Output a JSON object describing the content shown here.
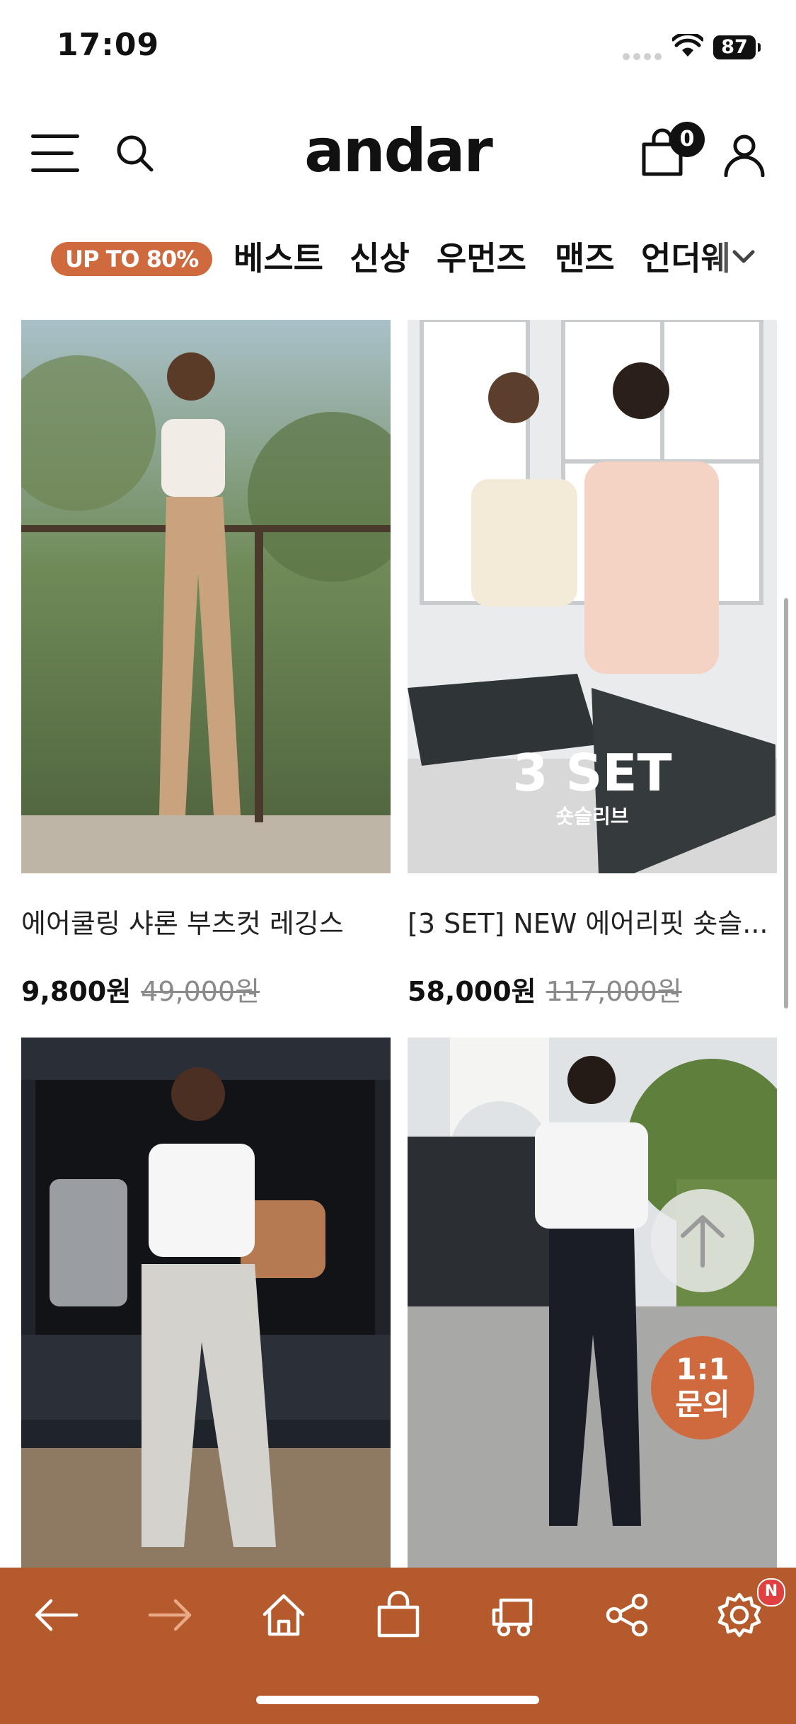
{
  "status": {
    "time": "17:09",
    "battery": "87"
  },
  "header": {
    "logo": "andar",
    "cart_count": "0"
  },
  "nav": {
    "promo": "UP TO 80%",
    "categories": [
      "베스트",
      "신상",
      "우먼즈",
      "맨즈",
      "언더웨"
    ]
  },
  "products": [
    {
      "name": "에어쿨링 샤론 부츠컷 레깅스",
      "price": "9,800원",
      "old_price": "49,000원"
    },
    {
      "name": "[3 SET] NEW 에어리핏 숏슬...",
      "price": "58,000원",
      "old_price": "117,000원",
      "overlay_title": "3 SET",
      "overlay_sub": "숏슬리브"
    },
    {
      "name": "",
      "price": "",
      "old_price": ""
    },
    {
      "name": "",
      "price": "",
      "old_price": ""
    }
  ],
  "floating": {
    "inquiry_line1": "1:1",
    "inquiry_line2": "문의"
  },
  "toolbar": {
    "icons": [
      "back-arrow-icon",
      "forward-arrow-icon",
      "home-icon",
      "shopping-bag-icon",
      "delivery-truck-icon",
      "share-icon",
      "settings-icon"
    ],
    "settings_badge": "N"
  },
  "colors": {
    "accent": "#cf6a3f",
    "toolbar_bg": "#b55a2c"
  }
}
